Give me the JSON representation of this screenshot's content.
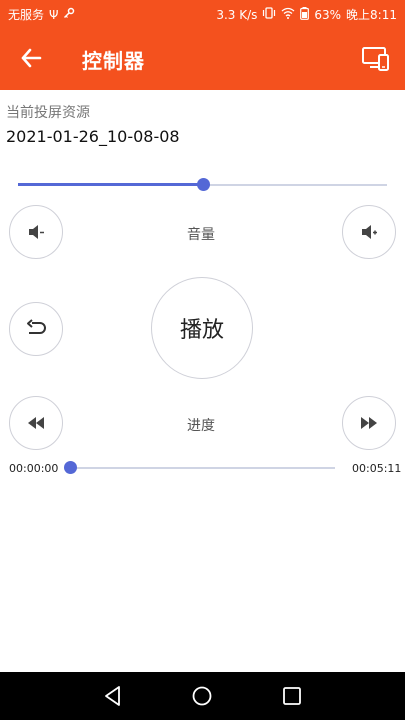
{
  "status_bar": {
    "carrier": "无服务",
    "speed": "3.3 K/s",
    "battery": "63%",
    "time": "晚上8:11",
    "icons": [
      "usb-icon",
      "key-icon",
      "vibrate-icon",
      "wifi-icon",
      "battery-icon"
    ]
  },
  "app_bar": {
    "title": "控制器",
    "back_icon": "arrow-left-icon",
    "cast_icon": "cast-screen-icon",
    "color": "#f4511e"
  },
  "source": {
    "label": "当前投屏资源",
    "value": "2021-01-26_10-08-08"
  },
  "volume": {
    "label": "音量",
    "level_percent": 50,
    "down_icon": "volume-down-icon",
    "up_icon": "volume-up-icon"
  },
  "playback": {
    "play_label": "播放",
    "back_icon": "return-icon"
  },
  "progress": {
    "label": "进度",
    "current_time": "00:00:00",
    "total_time": "00:05:11",
    "position_percent": 0,
    "rewind_icon": "rewind-icon",
    "forward_icon": "fast-forward-icon"
  },
  "accent_color": "#5468d6",
  "nav_bar": {
    "back_icon": "nav-back-icon",
    "home_icon": "nav-home-icon",
    "recents_icon": "nav-recents-icon"
  }
}
